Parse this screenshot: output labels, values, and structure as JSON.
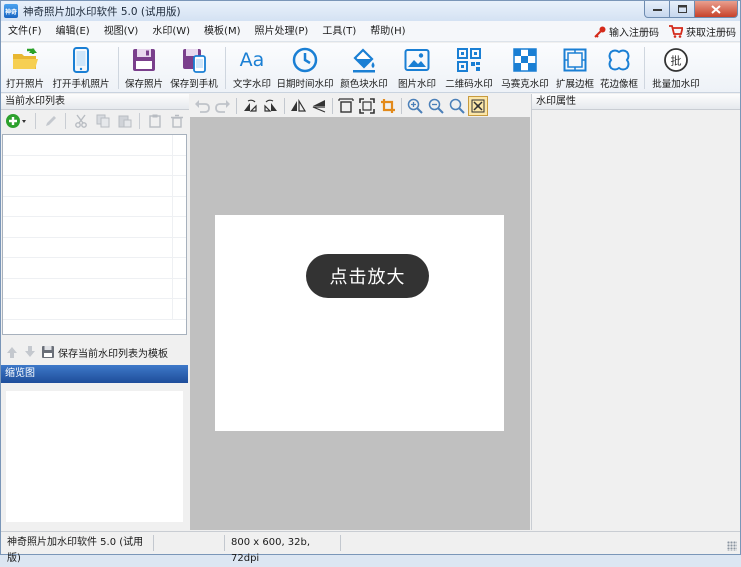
{
  "window": {
    "title": "神奇照片加水印软件 5.0 (试用版)",
    "app_icon_text": "神奇"
  },
  "menu": {
    "items": [
      "文件(F)",
      "编辑(E)",
      "视图(V)",
      "水印(W)",
      "模板(M)",
      "照片处理(P)",
      "工具(T)",
      "帮助(H)"
    ],
    "enter_code": "输入注册码",
    "get_code": "获取注册码"
  },
  "toolbar": {
    "open_photo": "打开照片",
    "open_phone_photo": "打开手机照片",
    "save_photo": "保存照片",
    "save_to_phone": "保存到手机",
    "text_watermark": "文字水印",
    "datetime_watermark": "日期时间水印",
    "color_block_watermark": "颜色块水印",
    "image_watermark": "图片水印",
    "qrcode_watermark": "二维码水印",
    "mosaic_watermark": "马赛克水印",
    "extend_border": "扩展边框",
    "lace_border": "花边像框",
    "batch_watermark": "批量加水印",
    "text_icon_glyph": "Aa",
    "batch_icon_glyph": "批"
  },
  "left_panel": {
    "list_title": "当前水印列表",
    "save_template": "保存当前水印列表为模板",
    "thumbnail_title": "缩览图"
  },
  "canvas": {
    "zoom_hint": "点击放大"
  },
  "right_panel": {
    "title": "水印属性"
  },
  "status": {
    "app_name": "神奇照片加水印软件 5.0 (试用版)",
    "image_info": "800 x 600, 32b, 72dpi"
  },
  "colors": {
    "accent_blue": "#1a7fd4",
    "save_purple": "#7a3f8c",
    "thumb_header": "#2a5fae"
  }
}
